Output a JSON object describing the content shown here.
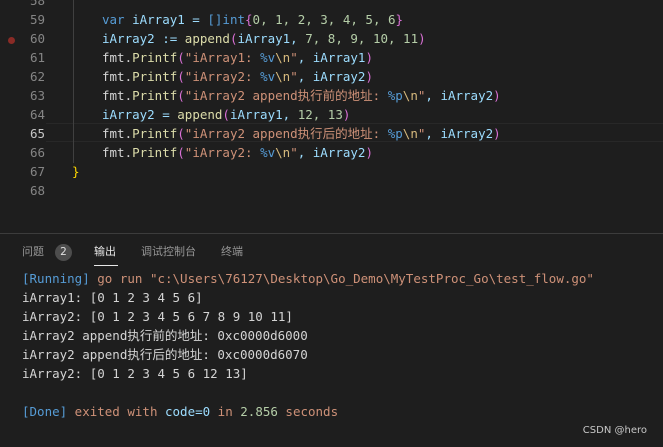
{
  "editor": {
    "lines": [
      {
        "n": "58"
      },
      {
        "n": "59"
      },
      {
        "n": "60"
      },
      {
        "n": "61"
      },
      {
        "n": "62"
      },
      {
        "n": "63"
      },
      {
        "n": "64"
      },
      {
        "n": "65"
      },
      {
        "n": "66"
      },
      {
        "n": "67"
      },
      {
        "n": "68"
      }
    ],
    "code": {
      "l59": {
        "kw": "var",
        "name": " iArray1 = ",
        "type": "[]int",
        "open": "{",
        "nums": "0, 1, 2, 3, 4, 5, 6",
        "close": "}"
      },
      "l60": {
        "name": "iArray2 := ",
        "fn": "append",
        "open": "(",
        "args": "iArray1, ",
        "nums": "7, 8, 9, 10, 11",
        "close": ")"
      },
      "l61": {
        "pkg": "fmt.",
        "fn": "Printf",
        "open": "(",
        "s1": "\"iArray1: ",
        "fmt": "%v",
        "esc": "\\n",
        "s2": "\"",
        "rest": ", iArray1",
        "close": ")"
      },
      "l62": {
        "pkg": "fmt.",
        "fn": "Printf",
        "open": "(",
        "s1": "\"iArray2: ",
        "fmt": "%v",
        "esc": "\\n",
        "s2": "\"",
        "rest": ", iArray2",
        "close": ")"
      },
      "l63": {
        "pkg": "fmt.",
        "fn": "Printf",
        "open": "(",
        "s1": "\"iArray2 append执行前的地址: ",
        "fmt": "%p",
        "esc": "\\n",
        "s2": "\"",
        "rest": ", iArray2",
        "close": ")"
      },
      "l64": {
        "name": "iArray2 = ",
        "fn": "append",
        "open": "(",
        "args": "iArray1, ",
        "nums": "12, 13",
        "close": ")"
      },
      "l65": {
        "pkg": "fmt.",
        "fn": "Printf",
        "open": "(",
        "s1": "\"iArray2 append执行后的地址: ",
        "fmt": "%p",
        "esc": "\\n",
        "s2": "\"",
        "rest": ", iArray2",
        "close": ")"
      },
      "l66": {
        "pkg": "fmt.",
        "fn": "Printf",
        "open": "(",
        "s1": "\"iArray2: ",
        "fmt": "%v",
        "esc": "\\n",
        "s2": "\"",
        "rest": ", iArray2",
        "close": ")"
      },
      "l67": {
        "brace": "}"
      }
    }
  },
  "panel": {
    "tabs": {
      "problems": "问题",
      "problems_count": "2",
      "output": "输出",
      "debug_console": "调试控制台",
      "terminal": "终端"
    },
    "output": {
      "running_tag": "[Running]",
      "running_cmd": " go run \"c:\\Users\\76127\\Desktop\\Go_Demo\\MyTestProc_Go\\test_flow.go\"",
      "lines": [
        "iArray1: [0 1 2 3 4 5 6]",
        "iArray2: [0 1 2 3 4 5 6 7 8 9 10 11]",
        "iArray2 append执行前的地址: 0xc0000d6000",
        "iArray2 append执行后的地址: 0xc0000d6070",
        "iArray2: [0 1 2 3 4 5 6 12 13]"
      ],
      "done_tag": "[Done]",
      "done_text_1": " exited with ",
      "done_code": "code=0",
      "done_text_2": " in ",
      "done_time": "2.856",
      "done_text_3": " seconds"
    }
  },
  "watermark": "CSDN @hero"
}
